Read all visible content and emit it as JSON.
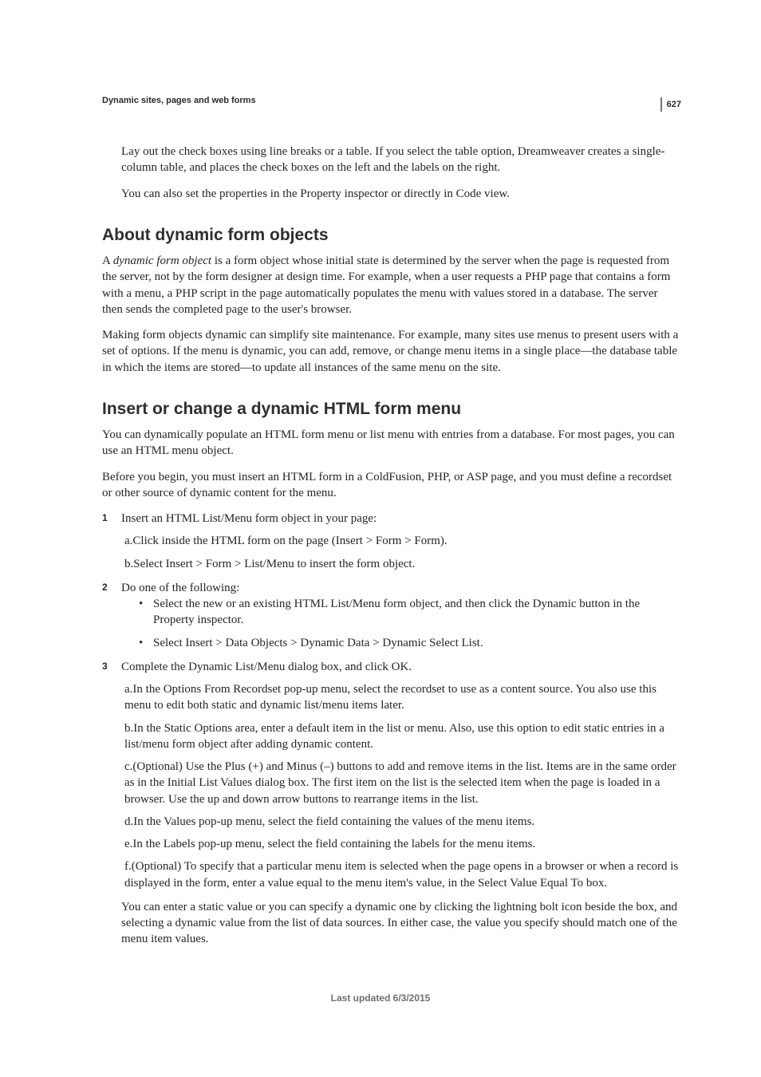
{
  "page_number": "627",
  "running_header": "Dynamic sites, pages and web forms",
  "intro_paras": [
    "Lay out the check boxes using line breaks or a table. If you select the table option, Dreamweaver creates a single-column table, and places the check boxes on the left and the labels on the right.",
    "You can also set the properties in the Property inspector or directly in Code view."
  ],
  "section1": {
    "heading": "About dynamic form objects",
    "p1_prefix": "A ",
    "p1_em": "dynamic form object",
    "p1_rest": " is a form object whose initial state is determined by the server when the page is requested from the server, not by the form designer at design time. For example, when a user requests a PHP page that contains a form with a menu, a PHP script in the page automatically populates the menu with values stored in a database. The server then sends the completed page to the user's browser.",
    "p2": "Making form objects dynamic can simplify site maintenance. For example, many sites use menus to present users with a set of options. If the menu is dynamic, you can add, remove, or change menu items in a single place—the database table in which the items are stored—to update all instances of the same menu on the site."
  },
  "section2": {
    "heading": "Insert or change a dynamic HTML form menu",
    "p1": "You can dynamically populate an HTML form menu or list menu with entries from a database. For most pages, you can use an HTML menu object.",
    "p2": "Before you begin, you must insert an HTML form in a ColdFusion, PHP, or ASP page, and you must define a recordset or other source of dynamic content for the menu.",
    "steps": [
      {
        "num": "1",
        "text": "Insert an HTML List/Menu form object in your page:",
        "subs": [
          "a.Click inside the HTML form on the page (Insert > Form > Form).",
          "b.Select Insert > Form > List/Menu to insert the form object."
        ]
      },
      {
        "num": "2",
        "text": "Do one of the following:",
        "bullets": [
          "Select the new or an existing HTML List/Menu form object, and then click the Dynamic button in the Property inspector.",
          "Select Insert > Data Objects > Dynamic Data > Dynamic Select List."
        ]
      },
      {
        "num": "3",
        "text": "Complete the Dynamic List/Menu dialog box, and click OK.",
        "subs": [
          "a.In the Options From Recordset pop-up menu, select the recordset to use as a content source. You also use this menu to edit both static and dynamic list/menu items later.",
          "b.In the Static Options area, enter a default item in the list or menu. Also, use this option to edit static entries in a list/menu form object after adding dynamic content.",
          "c.(Optional) Use the Plus (+) and Minus (–) buttons to add and remove items in the list. Items are in the same order as in the Initial List Values dialog box. The first item on the list is the selected item when the page is loaded in a browser. Use the up and down arrow buttons to rearrange items in the list.",
          "d.In the Values pop-up menu, select the field containing the values of the menu items.",
          "e.In the Labels pop-up menu, select the field containing the labels for the menu items.",
          "f.(Optional) To specify that a particular menu item is selected when the page opens in a browser or when a record is displayed in the form, enter a value equal to the menu item's value, in the Select Value Equal To box."
        ],
        "tail": "You can enter a static value or you can specify a dynamic one by clicking the lightning bolt icon beside the box, and selecting a dynamic value from the list of data sources. In either case, the value you specify should match one of the menu item values."
      }
    ]
  },
  "footer": "Last updated 6/3/2015"
}
